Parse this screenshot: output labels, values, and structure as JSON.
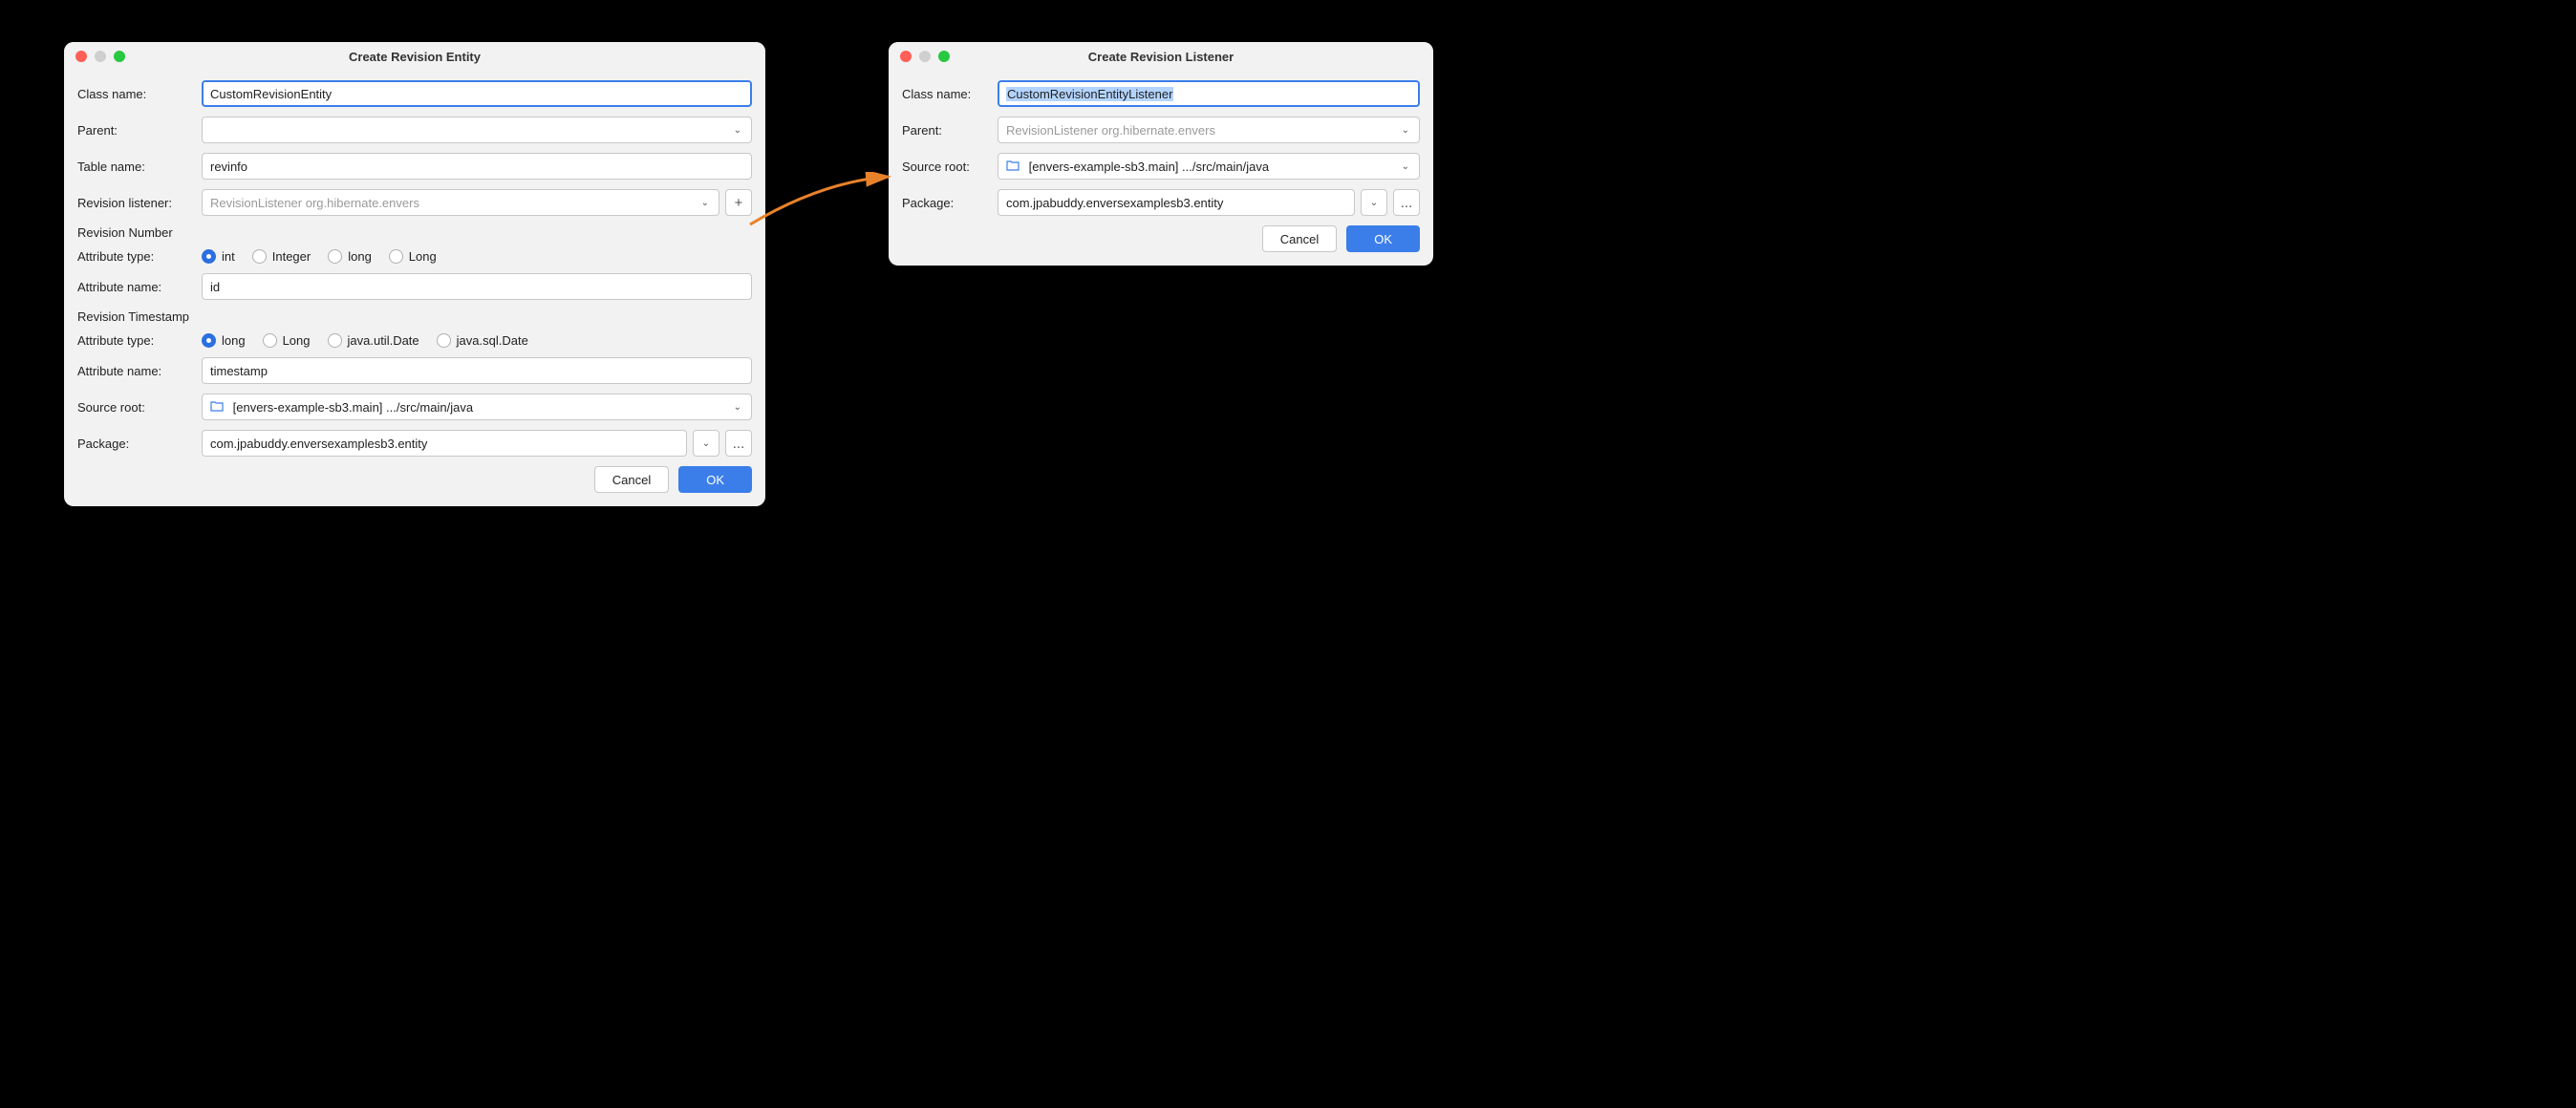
{
  "dialog1": {
    "title": "Create Revision Entity",
    "labels": {
      "class_name": "Class name:",
      "parent": "Parent:",
      "table_name": "Table name:",
      "revision_listener": "Revision listener:",
      "revision_number": "Revision Number",
      "attribute_type": "Attribute type:",
      "attribute_name": "Attribute name:",
      "revision_timestamp": "Revision Timestamp",
      "source_root": "Source root:",
      "package": "Package:"
    },
    "values": {
      "class_name": "CustomRevisionEntity",
      "parent": "",
      "table_name": "revinfo",
      "revision_listener_placeholder": "RevisionListener org.hibernate.envers",
      "rn_attr_name": "id",
      "rt_attr_name": "timestamp",
      "source_root": "[envers-example-sb3.main] .../src/main/java",
      "package": "com.jpabuddy.enversexamplesb3.entity"
    },
    "number_types": {
      "selected": "int",
      "options": [
        "int",
        "Integer",
        "long",
        "Long"
      ]
    },
    "timestamp_types": {
      "selected": "long",
      "options": [
        "long",
        "Long",
        "java.util.Date",
        "java.sql.Date"
      ]
    },
    "buttons": {
      "cancel": "Cancel",
      "ok": "OK",
      "plus": "+",
      "browse": "..."
    }
  },
  "dialog2": {
    "title": "Create Revision Listener",
    "labels": {
      "class_name": "Class name:",
      "parent": "Parent:",
      "source_root": "Source root:",
      "package": "Package:"
    },
    "values": {
      "class_name": "CustomRevisionEntityListener",
      "parent_placeholder": "RevisionListener org.hibernate.envers",
      "source_root": "[envers-example-sb3.main] .../src/main/java",
      "package": "com.jpabuddy.enversexamplesb3.entity"
    },
    "buttons": {
      "cancel": "Cancel",
      "ok": "OK",
      "browse": "..."
    }
  }
}
